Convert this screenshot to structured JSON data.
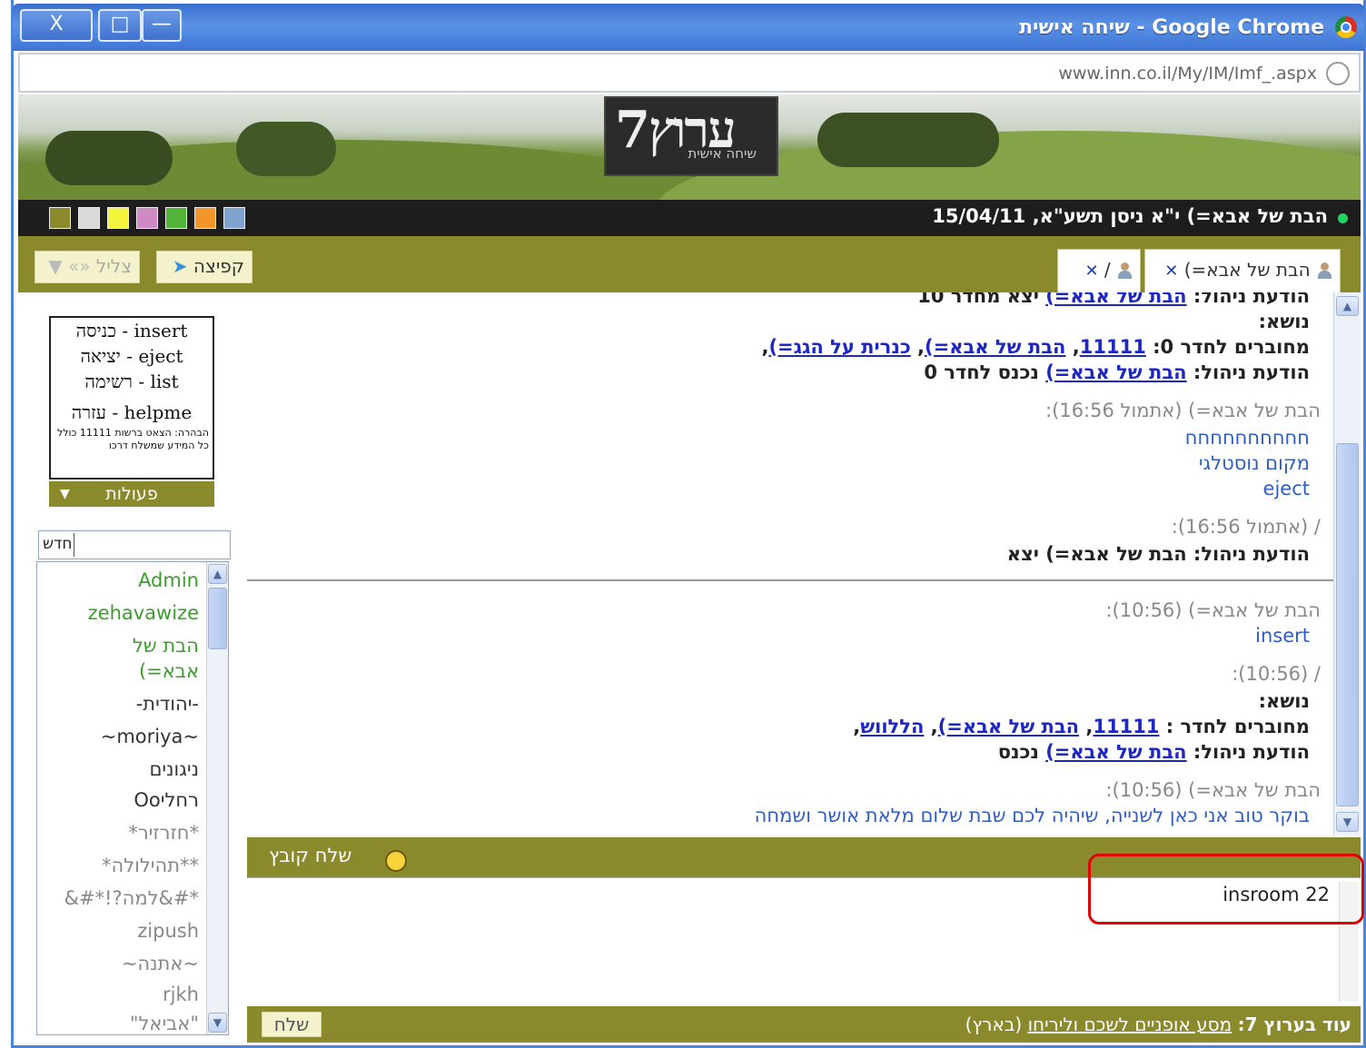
{
  "window": {
    "title": "Google Chrome - שיחה אישית",
    "close": "X",
    "restore": "□",
    "minimize": "—"
  },
  "address": {
    "url": "www.inn.co.il/My/IM/Imf_.aspx"
  },
  "logo": {
    "name": "ערוץ7",
    "subtitle": "שיחה אישית"
  },
  "status": {
    "user": "הבת של אבא=) י\"א ניסן תשע\"א, 15/04/11",
    "swatch_colors": [
      "#8a8a2d",
      "#d9d9d9",
      "#f3f33b",
      "#cf8ac4",
      "#52b53a",
      "#f2962a",
      "#7fa3cf"
    ]
  },
  "toolbar": {
    "jump_label": "קפיצה",
    "tsilil_label": "צליל",
    "tab1_label": "הבת של אבא=)",
    "tab2_label": "/"
  },
  "commands": {
    "insert": "insert - כניסה",
    "eject": "eject - יציאה",
    "list": "list - רשימה",
    "helpme": "helpme - עזרה",
    "note": "הבהרה: הצאט ברשות 11111 כולל כל המידע שמשלח דרכו",
    "actions": "פעולות"
  },
  "newroom": {
    "label": "חדש"
  },
  "users": [
    {
      "name": "Admin",
      "color": "#3a9e2a",
      "status": "g"
    },
    {
      "name": "zehavawize",
      "color": "#3a9e2a",
      "status": "g"
    },
    {
      "name": "הבת של",
      "color": "#3a9e2a",
      "status": "g"
    },
    {
      "name": "אבא=)",
      "color": "#3a9e2a",
      "status": ""
    },
    {
      "name": "-יהודית-",
      "color": "#333333",
      "status": "g"
    },
    {
      "name": "~moriya~",
      "color": "#333333",
      "status": "g"
    },
    {
      "name": "ניגונים",
      "color": "#333333",
      "status": "g"
    },
    {
      "name": "רחליOo",
      "color": "#333333",
      "status": "g"
    },
    {
      "name": "*חזרזיר*",
      "color": "#888888",
      "status": "r"
    },
    {
      "name": "**תהילולה*",
      "color": "#888888",
      "status": "r"
    },
    {
      "name": "*#&למה?!*#&",
      "color": "#888888",
      "status": "r"
    },
    {
      "name": "zipush",
      "color": "#888888",
      "status": "r"
    },
    {
      "name": "~אתנה~",
      "color": "#888888",
      "status": "r"
    },
    {
      "name": "rjkh",
      "color": "#888888",
      "status": "r"
    },
    {
      "name": "\"אביאל\"",
      "color": "#888888",
      "status": "r"
    }
  ],
  "chat": {
    "top_partial": {
      "prefix": "הודעת ניהול: ",
      "link": "הבת של אבא=)",
      "suffix": " יצא מחדר 10"
    },
    "subject1": "נושא:",
    "members1": {
      "prefix": "מחוברים לחדר 0: ",
      "l1": "11111",
      "l2": "הבת של אבא=)",
      "l3": "כנרית על הגג=)",
      "sep": ", ",
      "end": ","
    },
    "admin1": {
      "prefix": "הודעת ניהול: ",
      "link": "הבת של אבא=)",
      "suffix": " נכנס לחדר 0"
    },
    "msg1_head": "הבת של אבא=) (אתמול 16:56):",
    "msg1_l1": "חחחחחחחחחח",
    "msg1_l2": "מקום נוסטלגי",
    "msg1_l3": "eject",
    "msg2_head": "/ (אתמול 16:56):",
    "msg2_body": "הודעת ניהול: הבת של אבא=) יצא",
    "msg3_head": "הבת של אבא=) (10:56):",
    "msg3_body": "insert",
    "msg4_head": "/ (10:56):",
    "subject2": "נושא:",
    "members2": {
      "prefix": "מחוברים לחדר : ",
      "l1": "11111",
      "l2": "הבת של אבא=)",
      "l3": "הללווש",
      "sep": ", ",
      "end": ","
    },
    "admin2": {
      "prefix": "הודעת ניהול: ",
      "link": "הבת של אבא=)",
      "suffix": " נכנס"
    },
    "msg5_head": "הבת של אבא=) (10:56):",
    "msg5_body": "בוקר טוב אני כאן לשנייה, שיהיה לכם שבת שלום מלאת אושר ושמחה"
  },
  "input": {
    "send_file": "שלח קובץ",
    "value": "insroom 22",
    "send": "שלח"
  },
  "footer": {
    "label": "עוד בערוץ 7:",
    "link": "מסע אופניים לשכם וליריחו",
    "suffix": " (בארץ)"
  }
}
